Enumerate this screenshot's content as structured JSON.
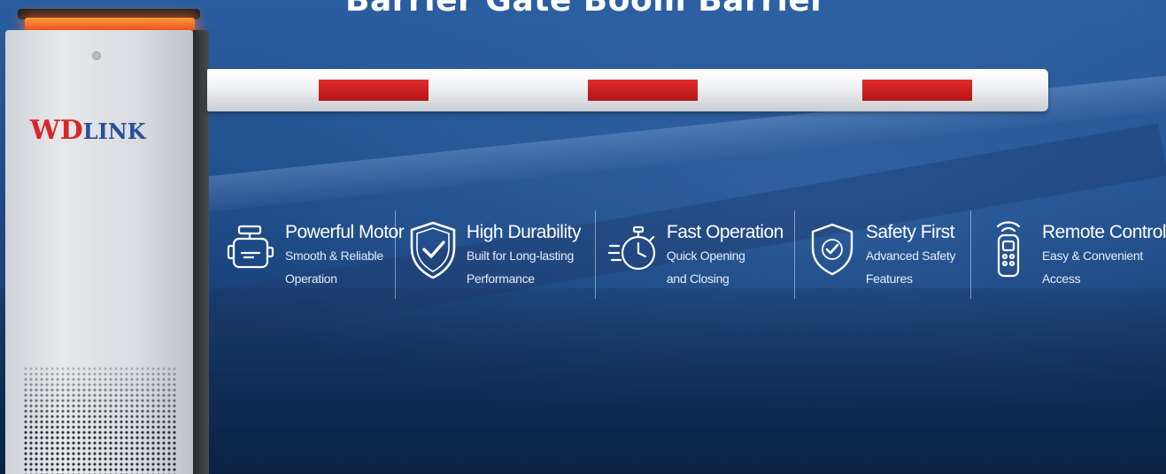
{
  "title": "Barrier Gate Boom Barrier",
  "brand": {
    "logo_wd": "WD",
    "logo_link": "LINK"
  },
  "colors": {
    "background": "#1b4a86",
    "stripe_red": "#d42020",
    "lamp_orange": "#ff7a2a",
    "logo_red": "#d9262c",
    "logo_blue": "#2a4f9a"
  },
  "features": [
    {
      "icon": "motor-icon",
      "name": "Powerful Motor",
      "line1": "Smooth & Reliable",
      "line2": "Operation"
    },
    {
      "icon": "shield-check-icon",
      "name": "High Durability",
      "line1": "Built for Long-lasting",
      "line2": "Performance"
    },
    {
      "icon": "stopwatch-icon",
      "name": "Fast Operation",
      "line1": "Quick Opening",
      "line2": "and Closing"
    },
    {
      "icon": "safety-shield-icon",
      "name": "Safety First",
      "line1": "Advanced Safety",
      "line2": "Features"
    },
    {
      "icon": "remote-control-icon",
      "name": "Remote Control",
      "line1": "Easy & Convenient",
      "line2": "Access"
    }
  ]
}
